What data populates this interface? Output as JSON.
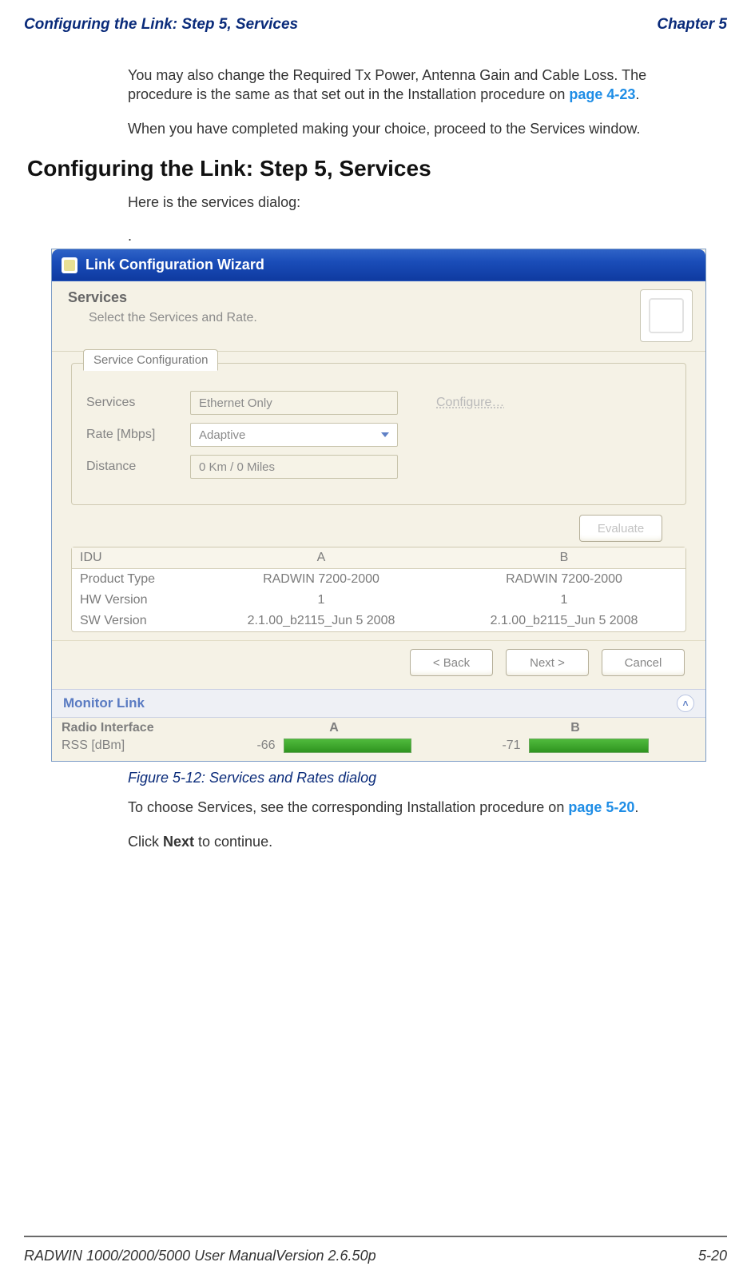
{
  "header": {
    "left": "Configuring the Link: Step 5, Services",
    "right": "Chapter 5"
  },
  "intro": {
    "para1_a": "You may also change the Required Tx Power, Antenna Gain and Cable Loss. The procedure is the same as that set out in the Installation procedure on ",
    "para1_link": "page 4-23",
    "para1_b": ".",
    "para2": "When you have completed making your choice, proceed to the Services window."
  },
  "section_heading": "Configuring the Link: Step 5, Services",
  "lead_in": "Here is the services dialog:",
  "wizard": {
    "title": "Link Configuration Wizard",
    "header_title": "Services",
    "header_sub": "Select the Services and Rate.",
    "group_tab": "Service Configuration",
    "rows": {
      "services_label": "Services",
      "services_value": "Ethernet Only",
      "configure_link": "Configure…",
      "rate_label": "Rate [Mbps]",
      "rate_value": "Adaptive",
      "distance_label": "Distance",
      "distance_value": "0 Km / 0 Miles"
    },
    "evaluate_btn": "Evaluate",
    "idu": {
      "head_a": "IDU",
      "head_b": "A",
      "head_c": "B",
      "rows": [
        {
          "label": "Product Type",
          "a": "RADWIN 7200-2000",
          "b": "RADWIN 7200-2000"
        },
        {
          "label": "HW Version",
          "a": "1",
          "b": "1"
        },
        {
          "label": "SW Version",
          "a": "2.1.00_b2115_Jun  5 2008",
          "b": "2.1.00_b2115_Jun  5 2008"
        }
      ]
    },
    "buttons": {
      "back": "< Back",
      "next": "Next >",
      "cancel": "Cancel"
    },
    "monitor_link": "Monitor Link",
    "radio": {
      "head_label": "Radio Interface",
      "col_a": "A",
      "col_b": "B",
      "rss_label": "RSS [dBm]",
      "rss_a": "-66",
      "rss_b": "-71"
    }
  },
  "figure_caption": "Figure 5-12: Services and Rates dialog",
  "post": {
    "para1_a": "To choose Services, see the corresponding Installation procedure on ",
    "para1_link": "page 5-20",
    "para1_b": ".",
    "para2_a": "Click ",
    "para2_bold": "Next",
    "para2_b": " to continue."
  },
  "footer": {
    "left": "RADWIN 1000/2000/5000 User ManualVersion  2.6.50p",
    "right": "5-20"
  }
}
